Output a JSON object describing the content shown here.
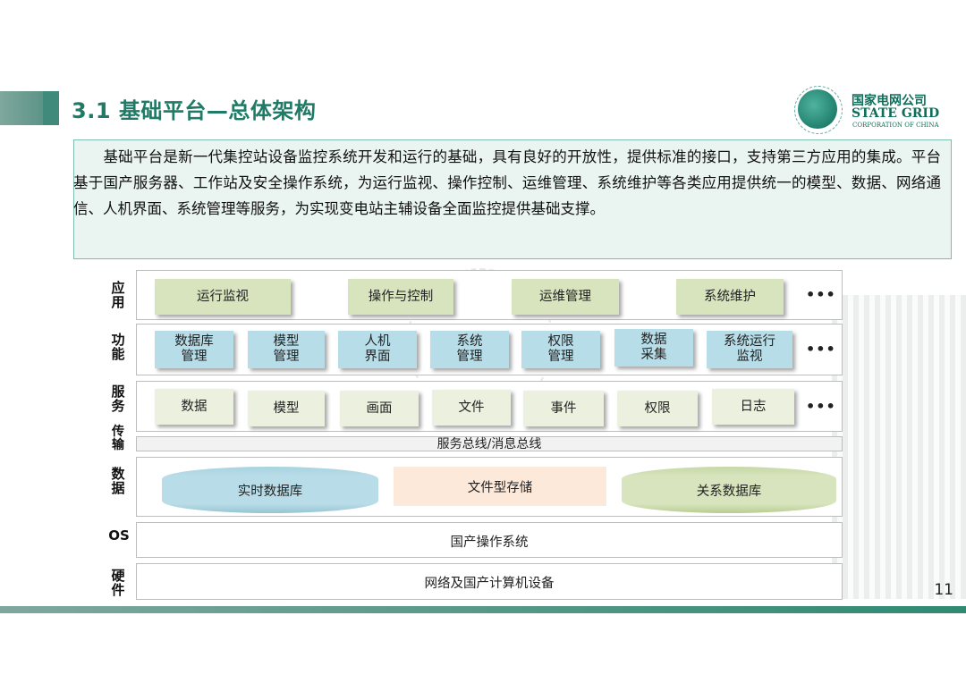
{
  "header": {
    "title": "3.1 基础平台—总体架构",
    "logo_cn": "国家电网公司",
    "logo_en": "STATE GRID",
    "logo_sub": "CORPORATION OF CHINA"
  },
  "intro": {
    "text": "　　基础平台是新一代集控站设备监控系统开发和运行的基础，具有良好的开放性，提供标准的接口，支持第三方应用的集成。平台基于国产服务器、工作站及安全操作系统，为运行监视、操作控制、运维管理、系统维护等各类应用提供统一的模型、数据、网络通信、人机界面、系统管理等服务，为实现变电站主辅设备全面监控提供基础支撑。"
  },
  "layers": {
    "app": {
      "label": "应用",
      "items": [
        "运行监视",
        "操作与控制",
        "运维管理",
        "系统维护"
      ],
      "more": "•••"
    },
    "func": {
      "label": "功能",
      "items": [
        "数据库\n管理",
        "模型\n管理",
        "人机\n界面",
        "系统\n管理",
        "权限\n管理",
        "数据\n采集",
        "系统运行\n监视"
      ],
      "more": "•••"
    },
    "svc": {
      "label": "服务",
      "items": [
        "数据",
        "模型",
        "画面",
        "文件",
        "事件",
        "权限",
        "日志"
      ],
      "more": "•••"
    },
    "trans": {
      "label": "传输",
      "bus": "服务总线/消息总线"
    },
    "data": {
      "label": "数据",
      "items": [
        "实时数据库",
        "文件型存储",
        "关系数据库"
      ]
    },
    "os": {
      "label": "OS",
      "text": "国产操作系统"
    },
    "hw": {
      "label": "硬件",
      "text": "网络及国产计算机设备"
    }
  },
  "page_number": "11"
}
